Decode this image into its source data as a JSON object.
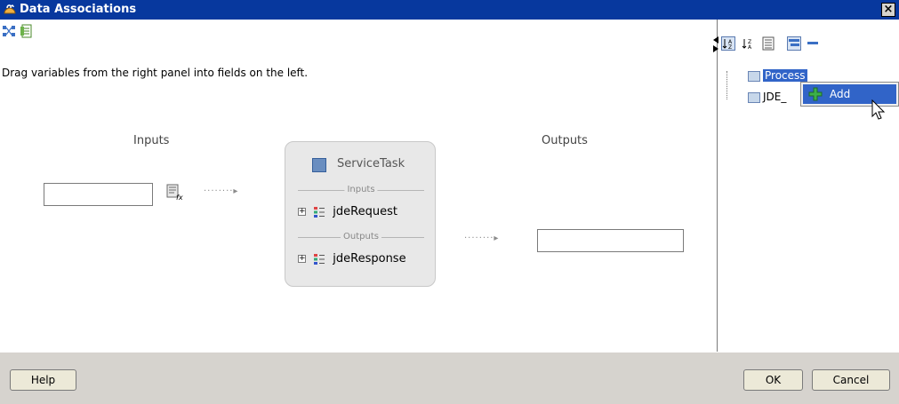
{
  "window": {
    "title": "Data Associations",
    "close_glyph": "×"
  },
  "left": {
    "instruction": "Drag variables from the right panel into fields on the left.",
    "inputs_label": "Inputs",
    "outputs_label": "Outputs",
    "input_value": "",
    "output_value": "",
    "service": {
      "title": "ServiceTask",
      "inputs_section": "Inputs",
      "outputs_section": "Outputs",
      "input_item": "jdeRequest",
      "output_item": "jdeResponse"
    }
  },
  "right": {
    "tree": [
      {
        "label": "Process"
      },
      {
        "label": "JDE_"
      }
    ],
    "context_menu": {
      "items": [
        {
          "label": "Add"
        }
      ]
    }
  },
  "buttons": {
    "help": "Help",
    "ok": "OK",
    "cancel": "Cancel"
  }
}
